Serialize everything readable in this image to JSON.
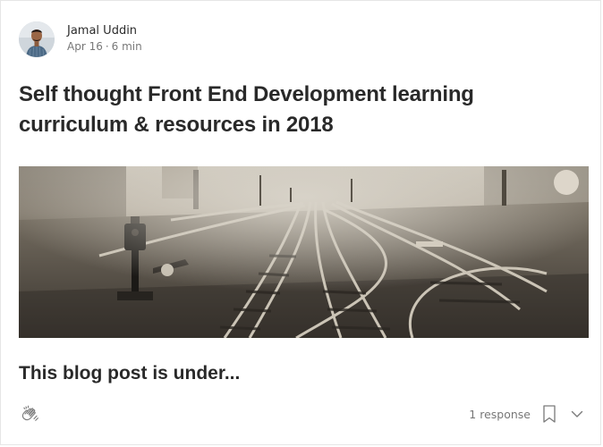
{
  "author": {
    "name": "Jamal Uddin",
    "avatar_icon": "author-avatar"
  },
  "post": {
    "date": "Apr 16",
    "separator": "·",
    "read_time": "6 min",
    "title": "Self thought Front End Development learning curriculum & resources in 2018",
    "excerpt": "This blog post is under...",
    "image_subject": "railway tracks in fog"
  },
  "footer": {
    "clap_icon": "clap-icon",
    "responses_label": "1 response",
    "bookmark_icon": "bookmark-icon",
    "more_icon": "chevron-down-icon"
  },
  "colors": {
    "text_primary": "rgba(0,0,0,0.84)",
    "text_secondary": "rgba(0,0,0,0.54)",
    "border": "#e6e6e6"
  }
}
